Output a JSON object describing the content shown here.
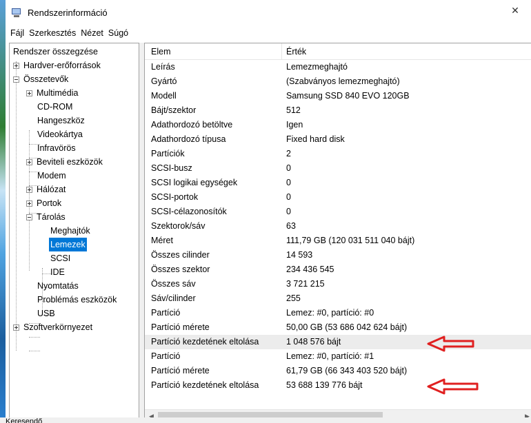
{
  "window": {
    "title": "Rendszerinformáció",
    "close_glyph": "✕",
    "icon": "system-info-icon"
  },
  "menu": [
    "Fájl",
    "Szerkesztés",
    "Nézet",
    "Súgó"
  ],
  "tree": {
    "items": [
      {
        "label": "Rendszer összegzése",
        "level": 0,
        "expander": "none"
      },
      {
        "label": "Hardver-erőforrások",
        "level": 1,
        "expander": "plus"
      },
      {
        "label": "Összetevők",
        "level": 1,
        "expander": "minus"
      },
      {
        "label": "Multimédia",
        "level": 2,
        "expander": "plus"
      },
      {
        "label": "CD-ROM",
        "level": 2,
        "expander": "none"
      },
      {
        "label": "Hangeszköz",
        "level": 2,
        "expander": "none"
      },
      {
        "label": "Videokártya",
        "level": 2,
        "expander": "none"
      },
      {
        "label": "Infravörös",
        "level": 2,
        "expander": "none"
      },
      {
        "label": "Beviteli eszközök",
        "level": 2,
        "expander": "plus"
      },
      {
        "label": "Modem",
        "level": 2,
        "expander": "none"
      },
      {
        "label": "Hálózat",
        "level": 2,
        "expander": "plus"
      },
      {
        "label": "Portok",
        "level": 2,
        "expander": "plus"
      },
      {
        "label": "Tárolás",
        "level": 2,
        "expander": "minus"
      },
      {
        "label": "Meghajtók",
        "level": 3,
        "expander": "none"
      },
      {
        "label": "Lemezek",
        "level": 3,
        "expander": "none",
        "selected": true
      },
      {
        "label": "SCSI",
        "level": 3,
        "expander": "none"
      },
      {
        "label": "IDE",
        "level": 3,
        "expander": "none"
      },
      {
        "label": "Nyomtatás",
        "level": 2,
        "expander": "none"
      },
      {
        "label": "Problémás eszközök",
        "level": 2,
        "expander": "none"
      },
      {
        "label": "USB",
        "level": 2,
        "expander": "none"
      },
      {
        "label": "Szoftverkörnyezet",
        "level": 1,
        "expander": "plus"
      }
    ]
  },
  "list": {
    "headers": {
      "elem": "Elem",
      "ertek": "Érték"
    },
    "rows": [
      {
        "elem": "Leírás",
        "ertek": "Lemezmeghajtó"
      },
      {
        "elem": "Gyártó",
        "ertek": "(Szabványos lemezmeghajtó)"
      },
      {
        "elem": "Modell",
        "ertek": "Samsung SSD 840 EVO 120GB"
      },
      {
        "elem": "Bájt/szektor",
        "ertek": "512"
      },
      {
        "elem": "Adathordozó betöltve",
        "ertek": "Igen"
      },
      {
        "elem": "Adathordozó típusa",
        "ertek": "Fixed hard disk"
      },
      {
        "elem": "Partíciók",
        "ertek": "2"
      },
      {
        "elem": "SCSI-busz",
        "ertek": "0"
      },
      {
        "elem": "SCSI logikai egységek",
        "ertek": "0"
      },
      {
        "elem": "SCSI-portok",
        "ertek": "0"
      },
      {
        "elem": "SCSI-célazonosítók",
        "ertek": "0"
      },
      {
        "elem": "Szektorok/sáv",
        "ertek": "63"
      },
      {
        "elem": "Méret",
        "ertek": "111,79 GB (120 031 511 040 bájt)"
      },
      {
        "elem": "Összes cilinder",
        "ertek": "14 593"
      },
      {
        "elem": "Összes szektor",
        "ertek": "234 436 545"
      },
      {
        "elem": "Összes sáv",
        "ertek": "3 721 215"
      },
      {
        "elem": "Sáv/cilinder",
        "ertek": "255"
      },
      {
        "elem": "Partíció",
        "ertek": "Lemez: #0, partíció: #0"
      },
      {
        "elem": "Partíció mérete",
        "ertek": "50,00 GB (53 686 042 624 bájt)"
      },
      {
        "elem": "Partíció kezdetének eltolása",
        "ertek": "1 048 576 bájt",
        "highlighted": true
      },
      {
        "elem": "Partíció",
        "ertek": "Lemez: #0, partíció: #1"
      },
      {
        "elem": "Partíció mérete",
        "ertek": "61,79 GB (66 343 403 520 bájt)"
      },
      {
        "elem": "Partíció kezdetének eltolása",
        "ertek": "53 688 139 776 bájt"
      }
    ]
  },
  "scrollbar": {
    "left_glyph": "◀",
    "right_glyph": "▶"
  },
  "status": {
    "text": "Keresendő"
  },
  "annotations": {
    "arrow_color": "#e02020"
  }
}
